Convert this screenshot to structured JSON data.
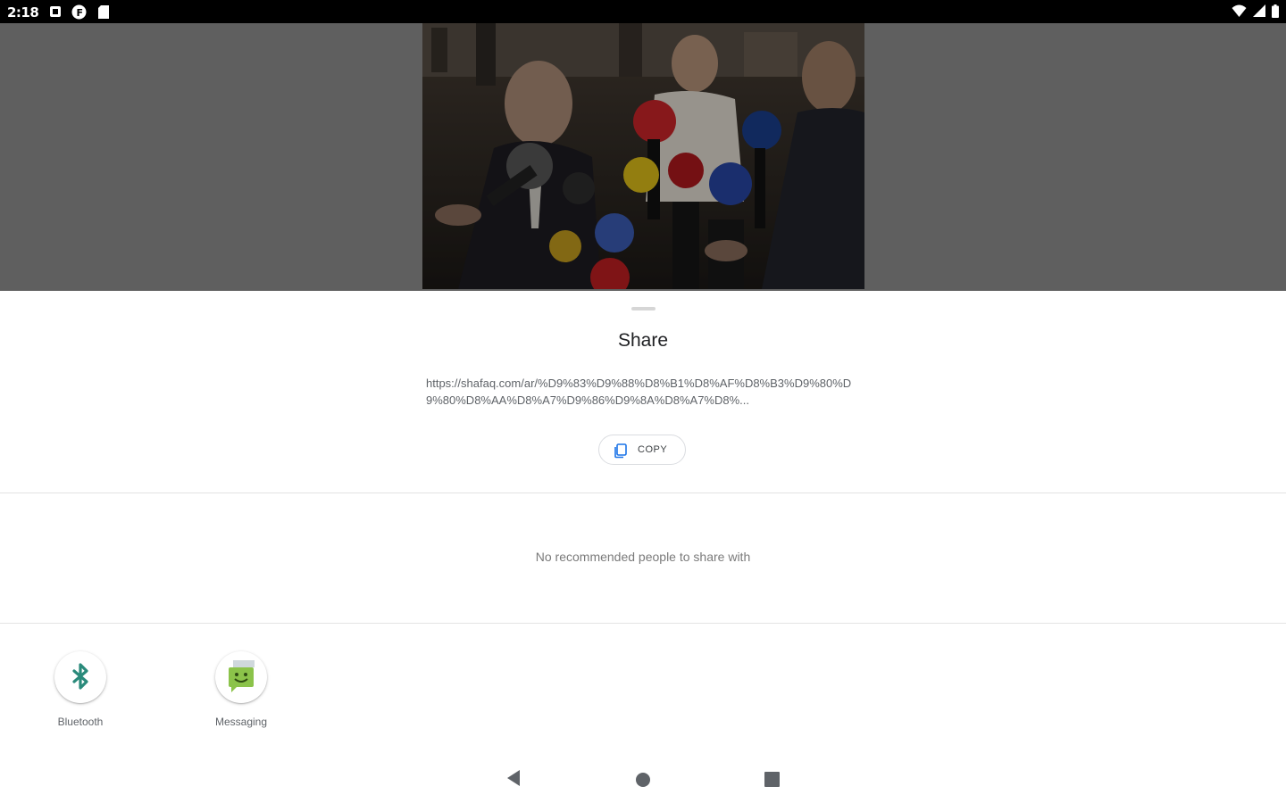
{
  "status_bar": {
    "time": "2:18",
    "left_icons": [
      "notification-icon",
      "app-notification-icon",
      "sd-card-icon"
    ],
    "right_icons": [
      "wifi-icon",
      "cell-signal-icon",
      "battery-icon"
    ]
  },
  "preview": {
    "image_name": "press-conference-photo"
  },
  "share_sheet": {
    "title": "Share",
    "url": "https://shafaq.com/ar/%D9%83%D9%88%D8%B1%D8%AF%D8%B3%D9%80%D9%80%D8%AA%D8%A7%D9%86%D9%8A%D8%A7%D8%...",
    "copy_label": "COPY",
    "no_people_text": "No recommended people to share with",
    "apps": [
      {
        "label": "Bluetooth",
        "icon": "bluetooth-icon",
        "color": "#2a8a7b"
      },
      {
        "label": "Messaging",
        "icon": "messaging-icon",
        "color": "#8bc34a"
      }
    ]
  },
  "nav_bar": {
    "buttons": [
      "back-icon",
      "home-icon",
      "recents-icon"
    ]
  },
  "colors": {
    "backdrop": "#5f5f5f",
    "status_bar": "#000000",
    "copy_icon": "#1a73e8",
    "bluetooth": "#2a8a7b",
    "messaging": "#8bc34a"
  }
}
